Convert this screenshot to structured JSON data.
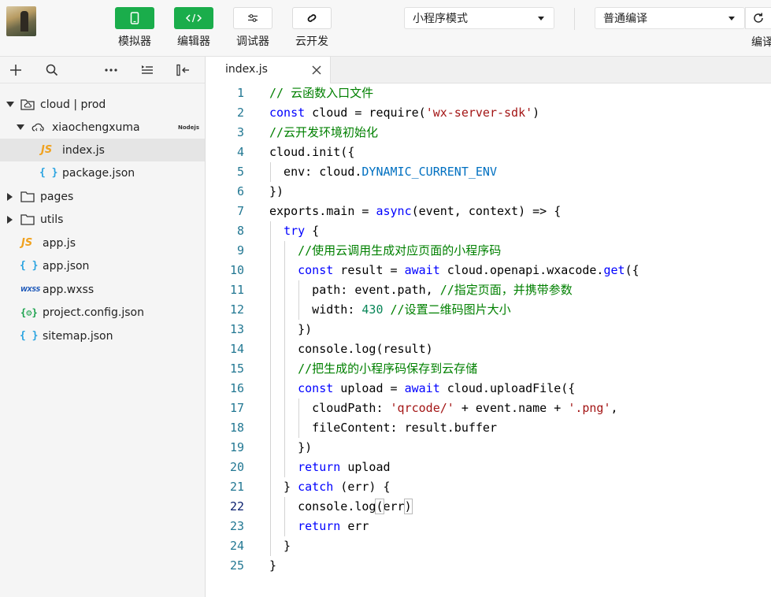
{
  "toolbar": {
    "buttons": [
      {
        "label": "模拟器",
        "icon": "phone-icon"
      },
      {
        "label": "编辑器",
        "icon": "code-icon"
      },
      {
        "label": "调试器",
        "icon": "sliders-icon"
      },
      {
        "label": "云开发",
        "icon": "cloud-link-icon"
      }
    ],
    "mode_select": "小程序模式",
    "compile_select": "普通编译",
    "cut_label": "编译"
  },
  "sidebar": {
    "tools": [
      "add-icon",
      "search-icon",
      "more-icon",
      "outline-icon",
      "collapse-sidebar-icon"
    ],
    "tree": [
      {
        "label": "cloud | prod",
        "icon": "cloud-folder-icon",
        "type": "folder",
        "expanded": true
      },
      {
        "label": "xiaochengxuma",
        "icon": "cloud-function-icon",
        "type": "folder",
        "expanded": true,
        "badge": "Nodejs"
      },
      {
        "label": "index.js",
        "icon_text": "JS",
        "type": "js",
        "selected": true
      },
      {
        "label": "package.json",
        "icon_text": "{ }",
        "type": "json"
      },
      {
        "label": "pages",
        "icon": "folder-icon",
        "type": "folder",
        "expanded": false
      },
      {
        "label": "utils",
        "icon": "folder-icon",
        "type": "folder",
        "expanded": false
      },
      {
        "label": "app.js",
        "icon_text": "JS",
        "type": "js"
      },
      {
        "label": "app.json",
        "icon_text": "{ }",
        "type": "json"
      },
      {
        "label": "app.wxss",
        "icon_text": "WXSS",
        "type": "wxss"
      },
      {
        "label": "project.config.json",
        "icon_text": "{⚙}",
        "type": "config"
      },
      {
        "label": "sitemap.json",
        "icon_text": "{ }",
        "type": "json"
      }
    ]
  },
  "editor": {
    "tab_label": "index.js",
    "active_line": 22,
    "lines": [
      {
        "n": "1",
        "indent": 0,
        "tokens": [
          [
            "comment",
            "// 云函数入口文件"
          ]
        ]
      },
      {
        "n": "2",
        "indent": 0,
        "tokens": [
          [
            "kw",
            "const"
          ],
          [
            "plain",
            " cloud = require("
          ],
          [
            "str",
            "'wx-server-sdk'"
          ],
          [
            "plain",
            ")"
          ]
        ]
      },
      {
        "n": "3",
        "indent": 0,
        "tokens": [
          [
            "comment",
            "//云开发环境初始化"
          ]
        ]
      },
      {
        "n": "4",
        "indent": 0,
        "tokens": [
          [
            "plain",
            "cloud.init({"
          ]
        ]
      },
      {
        "n": "5",
        "indent": 1,
        "tokens": [
          [
            "plain",
            "  env: cloud."
          ],
          [
            "const",
            "DYNAMIC_CURRENT_ENV"
          ]
        ]
      },
      {
        "n": "6",
        "indent": 0,
        "tokens": [
          [
            "plain",
            "})"
          ]
        ]
      },
      {
        "n": "7",
        "indent": 0,
        "tokens": [
          [
            "plain",
            "exports.main = "
          ],
          [
            "kw",
            "async"
          ],
          [
            "plain",
            "(event, context) => {"
          ]
        ]
      },
      {
        "n": "8",
        "indent": 1,
        "tokens": [
          [
            "plain",
            "  "
          ],
          [
            "kw",
            "try"
          ],
          [
            "plain",
            " {"
          ]
        ]
      },
      {
        "n": "9",
        "indent": 2,
        "tokens": [
          [
            "plain",
            "    "
          ],
          [
            "comment",
            "//使用云调用生成对应页面的小程序码"
          ]
        ]
      },
      {
        "n": "10",
        "indent": 2,
        "tokens": [
          [
            "plain",
            "    "
          ],
          [
            "kw",
            "const"
          ],
          [
            "plain",
            " result = "
          ],
          [
            "kw",
            "await"
          ],
          [
            "plain",
            " cloud.openapi.wxacode."
          ],
          [
            "kw",
            "get"
          ],
          [
            "plain",
            "({"
          ]
        ]
      },
      {
        "n": "11",
        "indent": 3,
        "tokens": [
          [
            "plain",
            "      path: event.path, "
          ],
          [
            "comment",
            "//指定页面，并携带参数"
          ]
        ]
      },
      {
        "n": "12",
        "indent": 3,
        "tokens": [
          [
            "plain",
            "      width: "
          ],
          [
            "num",
            "430"
          ],
          [
            "plain",
            " "
          ],
          [
            "comment",
            "//设置二维码图片大小"
          ]
        ]
      },
      {
        "n": "13",
        "indent": 2,
        "tokens": [
          [
            "plain",
            "    })"
          ]
        ]
      },
      {
        "n": "14",
        "indent": 2,
        "tokens": [
          [
            "plain",
            "    console.log(result)"
          ]
        ]
      },
      {
        "n": "15",
        "indent": 2,
        "tokens": [
          [
            "plain",
            "    "
          ],
          [
            "comment",
            "//把生成的小程序码保存到云存储"
          ]
        ]
      },
      {
        "n": "16",
        "indent": 2,
        "tokens": [
          [
            "plain",
            "    "
          ],
          [
            "kw",
            "const"
          ],
          [
            "plain",
            " upload = "
          ],
          [
            "kw",
            "await"
          ],
          [
            "plain",
            " cloud.uploadFile({"
          ]
        ]
      },
      {
        "n": "17",
        "indent": 3,
        "tokens": [
          [
            "plain",
            "      cloudPath: "
          ],
          [
            "str",
            "'qrcode/'"
          ],
          [
            "plain",
            " + event.name + "
          ],
          [
            "str",
            "'.png'"
          ],
          [
            "plain",
            ","
          ]
        ]
      },
      {
        "n": "18",
        "indent": 3,
        "tokens": [
          [
            "plain",
            "      fileContent: result.buffer"
          ]
        ]
      },
      {
        "n": "19",
        "indent": 2,
        "tokens": [
          [
            "plain",
            "    })"
          ]
        ]
      },
      {
        "n": "20",
        "indent": 2,
        "tokens": [
          [
            "plain",
            "    "
          ],
          [
            "kw",
            "return"
          ],
          [
            "plain",
            " upload"
          ]
        ]
      },
      {
        "n": "21",
        "indent": 1,
        "tokens": [
          [
            "plain",
            "  } "
          ],
          [
            "kw",
            "catch"
          ],
          [
            "plain",
            " (err) {"
          ]
        ]
      },
      {
        "n": "22",
        "indent": 2,
        "tokens": [
          [
            "plain",
            "    console.log"
          ],
          [
            "bracket",
            "("
          ],
          [
            "plain",
            "err"
          ],
          [
            "bracket",
            ")"
          ]
        ]
      },
      {
        "n": "23",
        "indent": 2,
        "tokens": [
          [
            "plain",
            "    "
          ],
          [
            "kw",
            "return"
          ],
          [
            "plain",
            " err"
          ]
        ]
      },
      {
        "n": "24",
        "indent": 1,
        "tokens": [
          [
            "plain",
            "  }"
          ]
        ]
      },
      {
        "n": "25",
        "indent": 0,
        "tokens": [
          [
            "plain",
            "}"
          ]
        ]
      }
    ]
  },
  "colors": {
    "accent_green": "#1aad4b",
    "comment": "#008000",
    "keyword": "#0000ff",
    "string": "#a31515",
    "number": "#098658",
    "constant": "#0070c1",
    "line_number": "#237893"
  }
}
